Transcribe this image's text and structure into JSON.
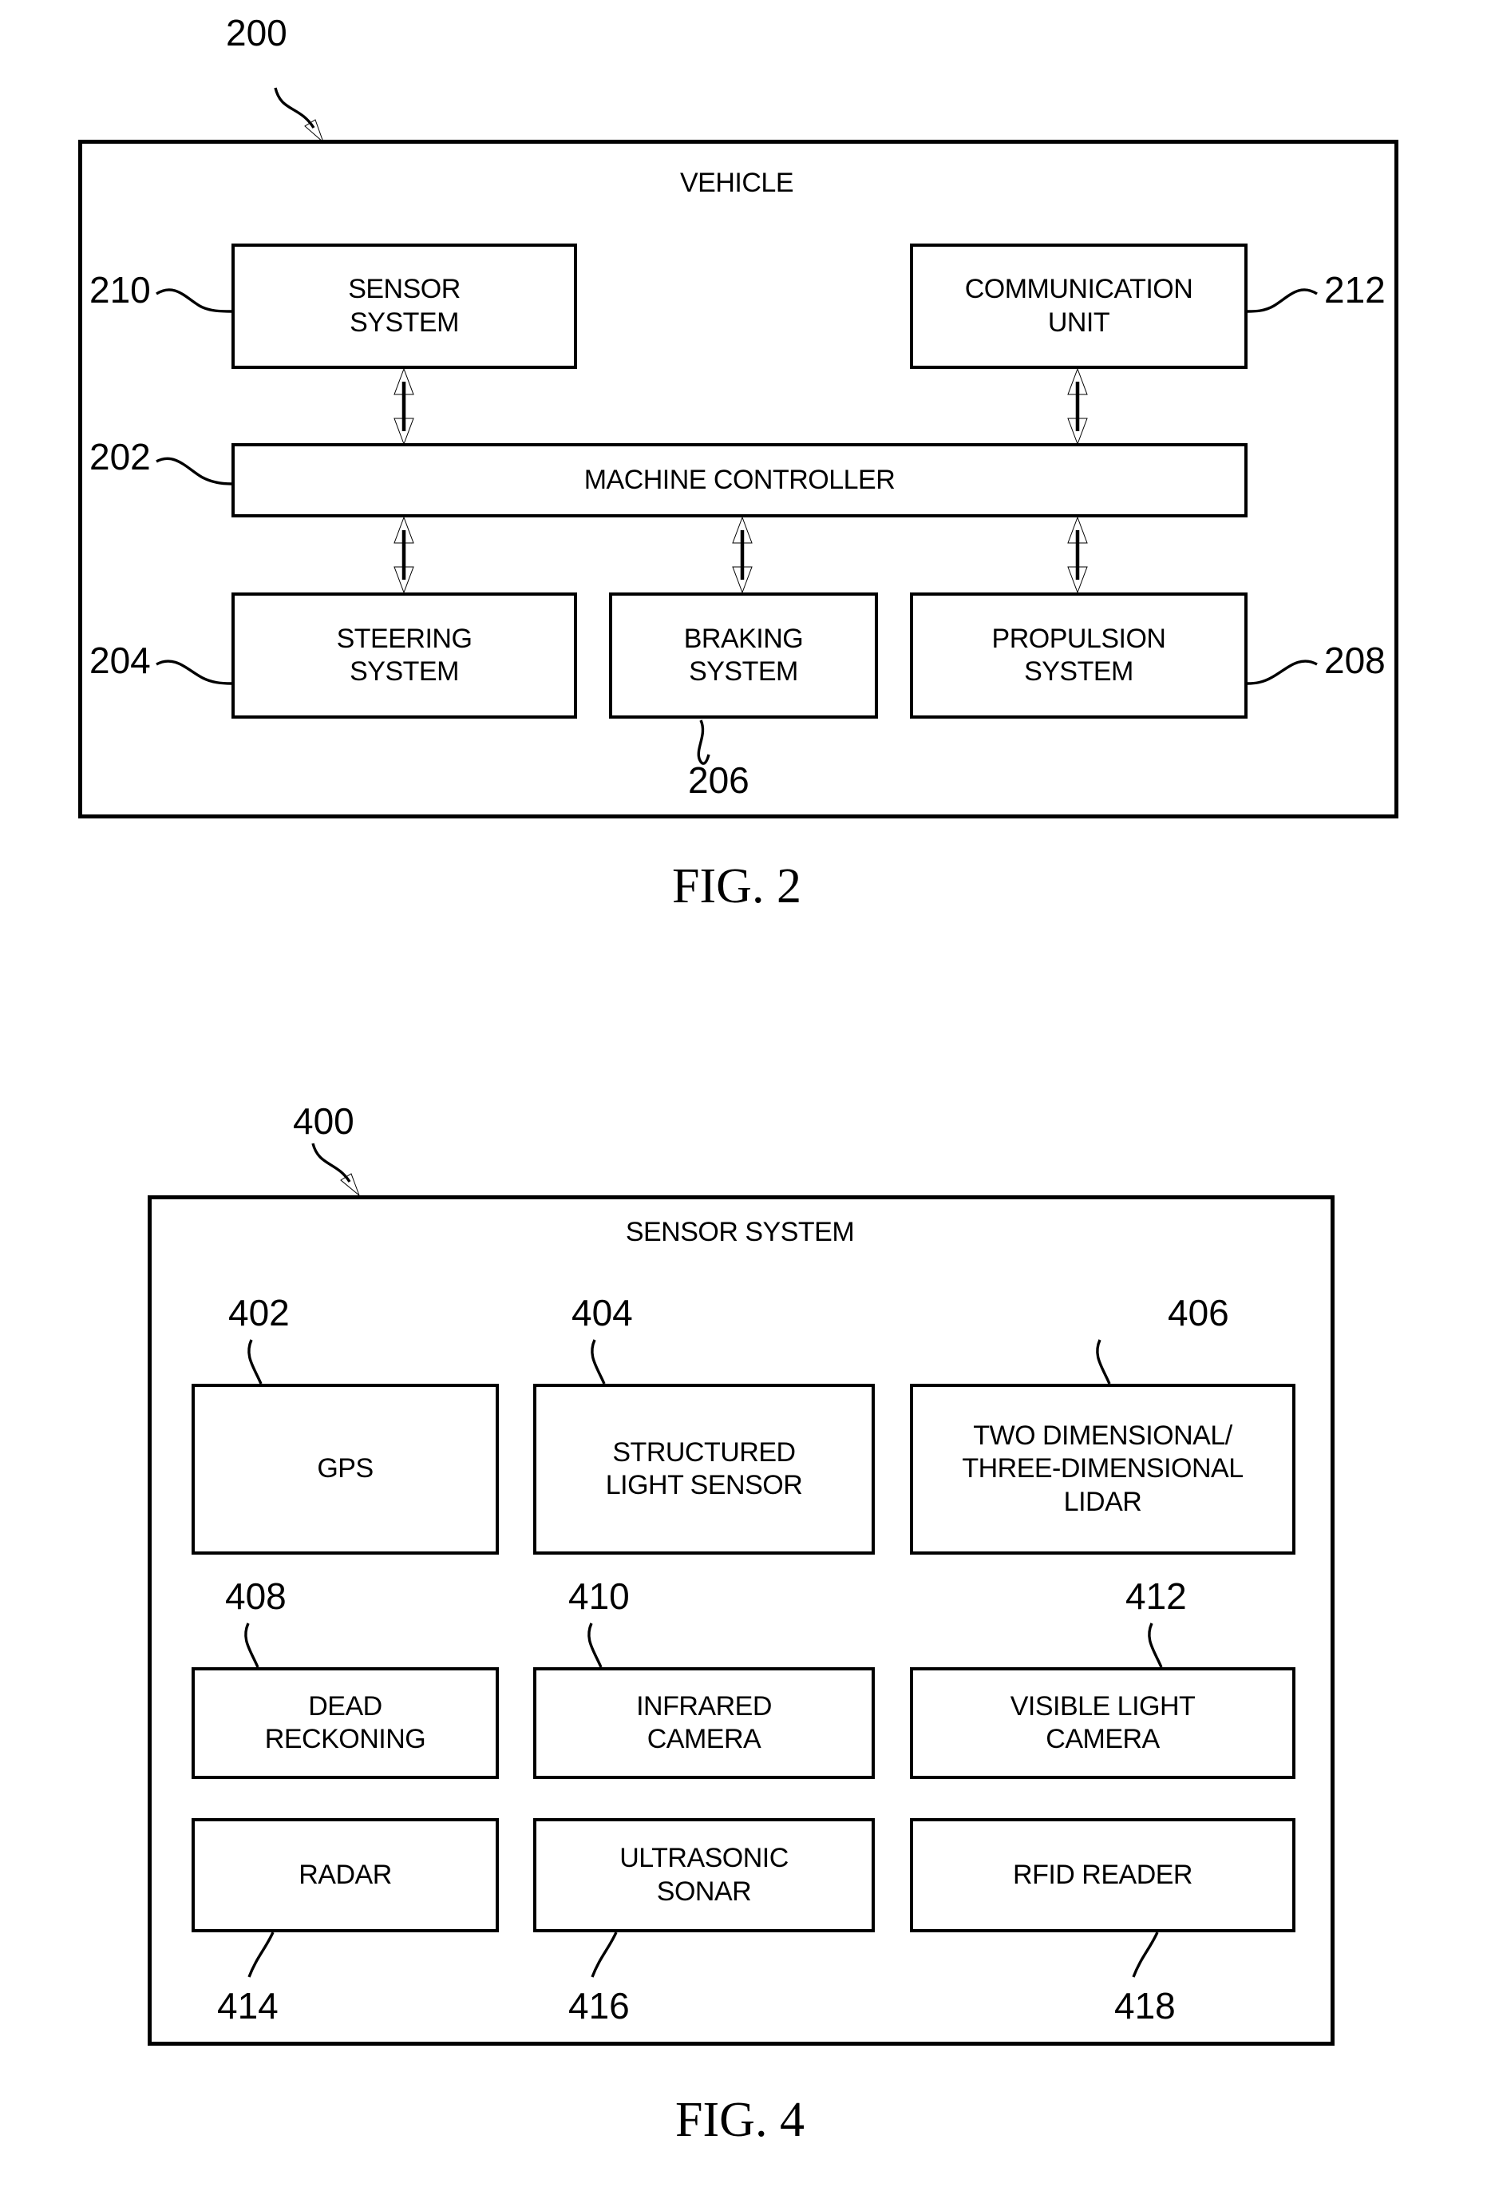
{
  "figure2": {
    "ref": "200",
    "title": "VEHICLE",
    "caption": "FIG. 2",
    "nodes": [
      {
        "id": "sensor-system",
        "ref": "210",
        "label": "SENSOR\nSYSTEM"
      },
      {
        "id": "communication-unit",
        "ref": "212",
        "label": "COMMUNICATION\nUNIT"
      },
      {
        "id": "machine-controller",
        "ref": "202",
        "label": "MACHINE CONTROLLER"
      },
      {
        "id": "steering-system",
        "ref": "204",
        "label": "STEERING\nSYSTEM"
      },
      {
        "id": "braking-system",
        "ref": "206",
        "label": "BRAKING\nSYSTEM"
      },
      {
        "id": "propulsion-system",
        "ref": "208",
        "label": "PROPULSION\nSYSTEM"
      }
    ]
  },
  "figure4": {
    "ref": "400",
    "title": "SENSOR SYSTEM",
    "caption": "FIG. 4",
    "nodes": [
      {
        "id": "gps",
        "ref": "402",
        "label": "GPS"
      },
      {
        "id": "structured-light",
        "ref": "404",
        "label": "STRUCTURED\nLIGHT SENSOR"
      },
      {
        "id": "lidar",
        "ref": "406",
        "label": "TWO DIMENSIONAL/\nTHREE-DIMENSIONAL\nLIDAR"
      },
      {
        "id": "dead-reckoning",
        "ref": "408",
        "label": "DEAD\nRECKONING"
      },
      {
        "id": "infrared-camera",
        "ref": "410",
        "label": "INFRARED\nCAMERA"
      },
      {
        "id": "visible-light-camera",
        "ref": "412",
        "label": "VISIBLE LIGHT\nCAMERA"
      },
      {
        "id": "radar",
        "ref": "414",
        "label": "RADAR"
      },
      {
        "id": "ultrasonic-sonar",
        "ref": "416",
        "label": "ULTRASONIC\nSONAR"
      },
      {
        "id": "rfid-reader",
        "ref": "418",
        "label": "RFID READER"
      }
    ]
  },
  "colors": {
    "ink": "#000000",
    "paper": "#ffffff"
  }
}
